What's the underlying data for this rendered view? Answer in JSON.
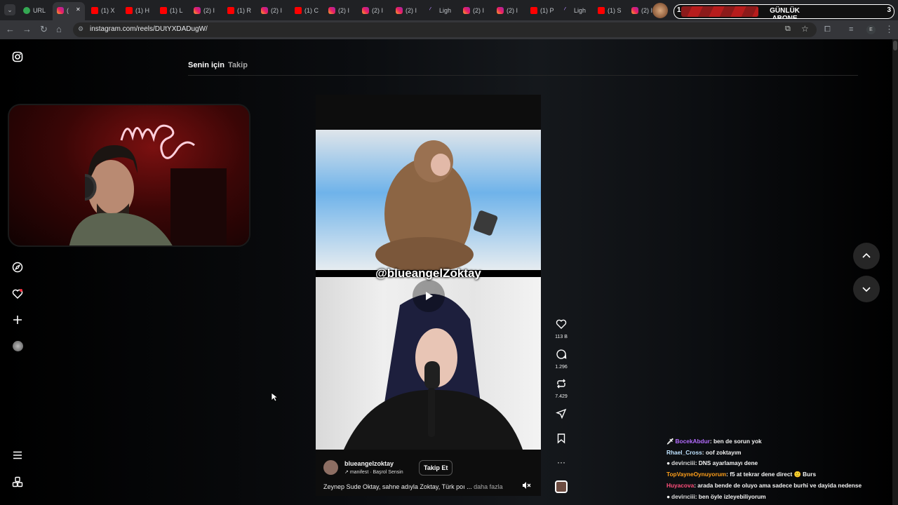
{
  "browser": {
    "tabs": [
      {
        "label": "URL",
        "icon": "green-circle"
      },
      {
        "label": "(",
        "icon": "instagram",
        "active": true
      },
      {
        "label": "(1) X",
        "icon": "youtube"
      },
      {
        "label": "(1) H",
        "icon": "youtube"
      },
      {
        "label": "(1) L",
        "icon": "youtube"
      },
      {
        "label": "(2) I",
        "icon": "instagram"
      },
      {
        "label": "(1) R",
        "icon": "youtube"
      },
      {
        "label": "(2) I",
        "icon": "instagram"
      },
      {
        "label": "(1) C",
        "icon": "youtube"
      },
      {
        "label": "(2) I",
        "icon": "instagram"
      },
      {
        "label": "(2) I",
        "icon": "instagram"
      },
      {
        "label": "(2) I",
        "icon": "instagram"
      },
      {
        "label": "Ligh",
        "icon": "lightshot"
      },
      {
        "label": "(2) I",
        "icon": "instagram"
      },
      {
        "label": "(2) I",
        "icon": "instagram"
      },
      {
        "label": "(1) P",
        "icon": "youtube"
      },
      {
        "label": "Ligh",
        "icon": "lightshot"
      },
      {
        "label": "(1) S",
        "icon": "youtube"
      },
      {
        "label": "(2) I",
        "icon": "instagram"
      }
    ],
    "url": "instagram.com/reels/DUtYXDADugW/"
  },
  "overlay": {
    "sub_title": "GÜNLÜK ABONE",
    "sub_left": "1",
    "sub_right": "3"
  },
  "reels": {
    "tab_for_you": "Senin için",
    "tab_following": "Takip",
    "video_handle": "@blueangelZoktay",
    "username": "blueangelzoktay",
    "music": "manifest · Başrol Sensin",
    "follow_label": "Takip Et",
    "caption": "Zeynep Sude Oktay, sahne adıyla Zoktay, Türk poı ...",
    "more_label": "daha fazla",
    "likes": "113 B",
    "comments": "1.296",
    "reposts": "7.429"
  },
  "chat": [
    {
      "user": "BocekAbdur",
      "color": "#b46cff",
      "text": "ben de sorun yok"
    },
    {
      "user": "Rhael_Cross",
      "color": "#bfe3ff",
      "text": "oof zoktayım"
    },
    {
      "user": "devirıciii",
      "color": "#dddddd",
      "text": "DNS ayarlamayı dene"
    },
    {
      "user": "TopVayneOynuyorum",
      "color": "#ff9f1a",
      "text": "f5 at tekrar dene direct 🙂 Burs"
    },
    {
      "user": "Huyacova",
      "color": "#ff4f7b",
      "text": "arada bende de oluyo ama sadece burhi ve dayida nedense"
    },
    {
      "user": "devirıciii",
      "color": "#dddddd",
      "text": "ben öyle izleyebiliyorum"
    }
  ]
}
